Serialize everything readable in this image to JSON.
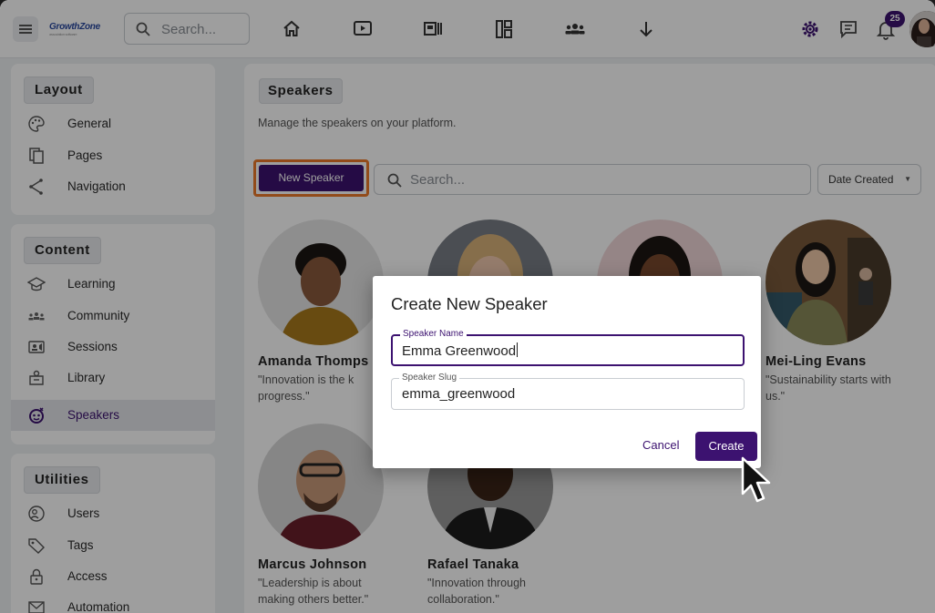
{
  "topbar": {
    "logo_text": "GrowthZone",
    "logo_tagline": "association software",
    "search_placeholder": "Search...",
    "nav_icons": [
      "home-icon",
      "video-icon",
      "media-icon",
      "dashboard-icon",
      "people-icon",
      "download-icon"
    ],
    "notification_count": "25"
  },
  "sidebar": {
    "sections": [
      {
        "title": "Layout",
        "items": [
          {
            "label": "General",
            "icon": "palette-icon"
          },
          {
            "label": "Pages",
            "icon": "pages-icon"
          },
          {
            "label": "Navigation",
            "icon": "share-icon"
          }
        ]
      },
      {
        "title": "Content",
        "items": [
          {
            "label": "Learning",
            "icon": "graduation-icon"
          },
          {
            "label": "Community",
            "icon": "community-icon"
          },
          {
            "label": "Sessions",
            "icon": "sessions-icon"
          },
          {
            "label": "Library",
            "icon": "library-icon"
          },
          {
            "label": "Speakers",
            "icon": "speakers-icon",
            "active": true
          }
        ]
      },
      {
        "title": "Utilities",
        "items": [
          {
            "label": "Users",
            "icon": "users-icon"
          },
          {
            "label": "Tags",
            "icon": "tag-icon"
          },
          {
            "label": "Access",
            "icon": "lock-icon"
          },
          {
            "label": "Automation",
            "icon": "mail-icon"
          }
        ]
      }
    ]
  },
  "main": {
    "title": "Speakers",
    "subtitle": "Manage the speakers on your platform.",
    "new_button": "New Speaker",
    "search_placeholder": "Search...",
    "sort_label": "Date Created",
    "speakers": [
      {
        "name": "Amanda Thomps",
        "quote": "\"Innovation is the k",
        "quote2": "progress.\""
      },
      {
        "name": "Mei-Ling Evans",
        "quote": "\"Sustainability starts with",
        "quote2": "us.\""
      },
      {
        "name": "Marcus Johnson",
        "quote": "\"Leadership is about",
        "quote2": "making others better.\""
      },
      {
        "name": "Rafael Tanaka",
        "quote": "\"Innovation through",
        "quote2": "collaboration.\""
      }
    ]
  },
  "dialog": {
    "title": "Create New Speaker",
    "name_label": "Speaker Name",
    "name_value": "Emma Greenwood",
    "slug_label": "Speaker Slug",
    "slug_value": "emma_greenwood",
    "cancel": "Cancel",
    "create": "Create"
  },
  "colors": {
    "accent": "#3c1270",
    "highlight_ring": "#ec7a2b",
    "overlay": "rgba(0,0,0,0.38)"
  }
}
